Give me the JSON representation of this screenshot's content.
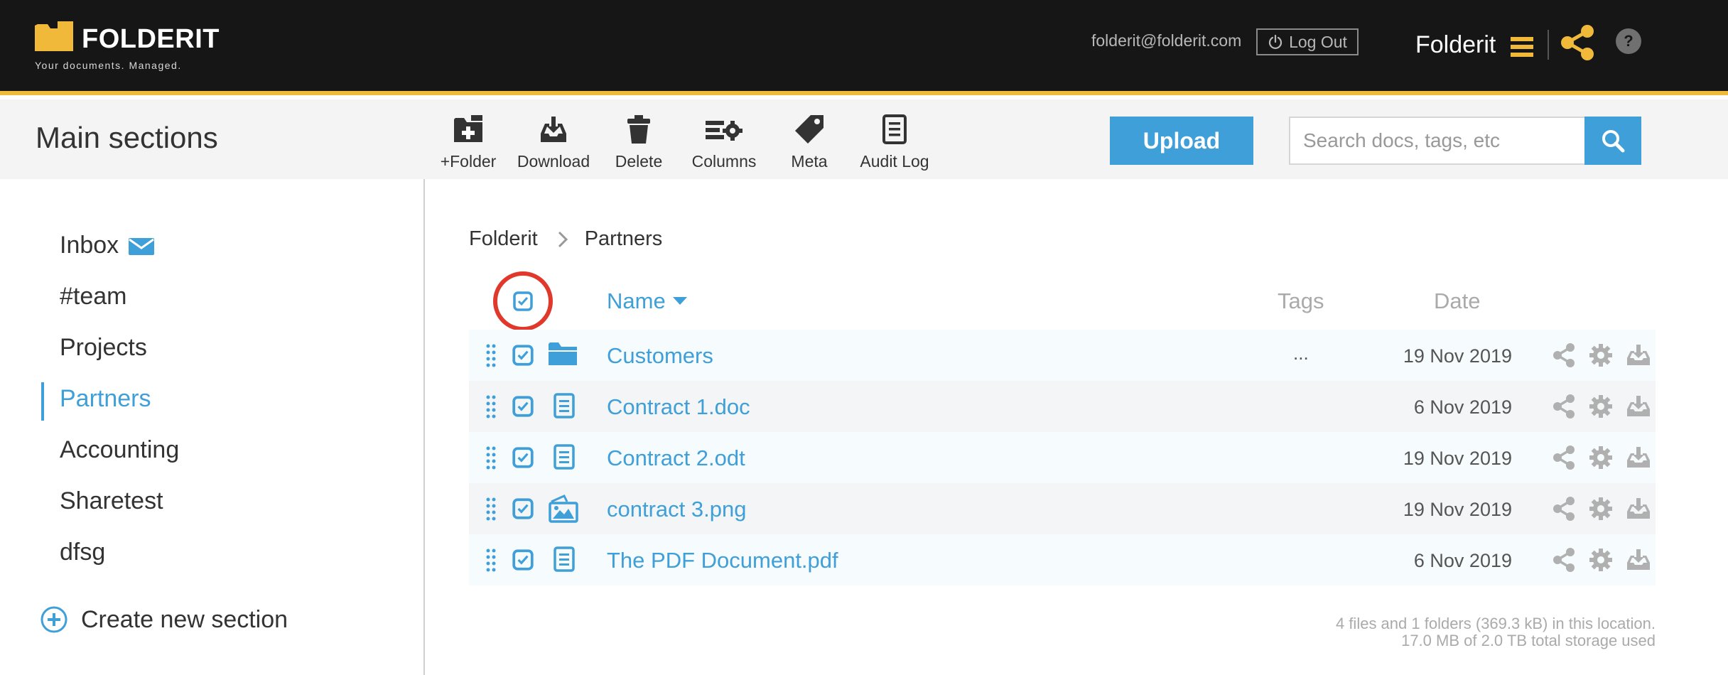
{
  "app": {
    "logo_name": "FOLDERIT",
    "tagline": "Your documents. Managed.",
    "user_email": "folderit@folderit.com",
    "logout_label": "Log Out",
    "brand": "Folderit",
    "help_label": "?",
    "accent_color": "#3f9fd8",
    "brand_color": "#f0b93a"
  },
  "toolbar": {
    "section_title": "Main sections",
    "tools": [
      {
        "label": "+Folder",
        "icon": "folder-plus-icon"
      },
      {
        "label": "Download",
        "icon": "download-tray-icon"
      },
      {
        "label": "Delete",
        "icon": "trash-icon"
      },
      {
        "label": "Columns",
        "icon": "columns-gear-icon"
      },
      {
        "label": "Meta",
        "icon": "tag-icon"
      },
      {
        "label": "Audit Log",
        "icon": "document-list-icon"
      }
    ],
    "upload_label": "Upload",
    "search_placeholder": "Search docs, tags, etc"
  },
  "sidebar": {
    "items": [
      {
        "label": "Inbox",
        "icon": "envelope-icon"
      },
      {
        "label": "#team"
      },
      {
        "label": "Projects"
      },
      {
        "label": "Partners",
        "active": true
      },
      {
        "label": "Accounting"
      },
      {
        "label": "Sharetest"
      },
      {
        "label": "dfsg"
      }
    ],
    "create_label": "Create new section"
  },
  "main": {
    "breadcrumb": [
      "Folderit",
      "Partners"
    ],
    "columns": {
      "name": "Name",
      "tags": "Tags",
      "date": "Date"
    },
    "sort": "name-descending",
    "files": [
      {
        "name": "Customers",
        "type": "folder",
        "tags": "...",
        "date": "19 Nov 2019",
        "checked": true
      },
      {
        "name": "Contract 1.doc",
        "type": "document",
        "tags": "",
        "date": "6 Nov 2019",
        "checked": true
      },
      {
        "name": "Contract 2.odt",
        "type": "document",
        "tags": "",
        "date": "19 Nov 2019",
        "checked": true
      },
      {
        "name": "contract 3.png",
        "type": "image",
        "tags": "",
        "date": "19 Nov 2019",
        "checked": true
      },
      {
        "name": "The PDF Document.pdf",
        "type": "document",
        "tags": "",
        "date": "6 Nov 2019",
        "checked": true
      }
    ],
    "footer_line1": "4 files and 1 folders (369.3 kB) in this location.",
    "footer_line2": "17.0 MB of 2.0 TB total storage used"
  }
}
